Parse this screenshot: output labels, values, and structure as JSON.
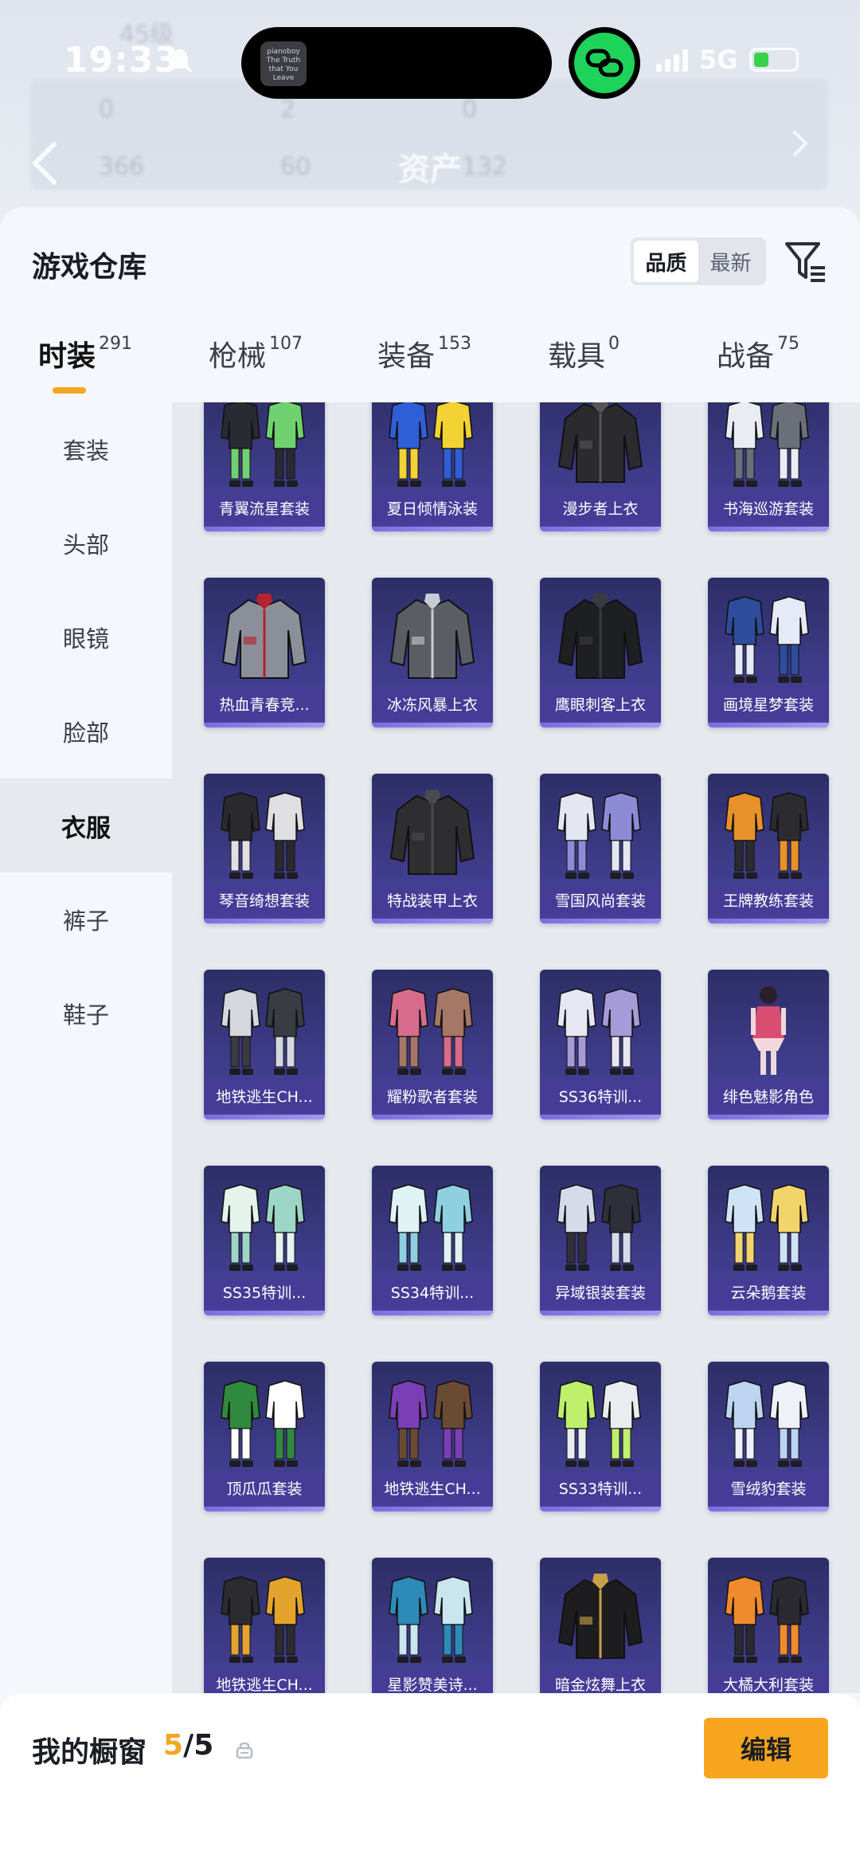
{
  "status_bar": {
    "time": "19:33",
    "network": "5G",
    "island_thumb_text": "pianoboy The Truth that You Leave"
  },
  "backdrop": {
    "title": "资产",
    "ghost_texts": [
      "45级",
      "0",
      "2",
      "0",
      "366",
      "60",
      "132"
    ]
  },
  "header": {
    "title": "游戏仓库",
    "sort_options": [
      "品质",
      "最新"
    ],
    "sort_active": "品质"
  },
  "tabs": [
    {
      "label": "时装",
      "count": "291",
      "active": true
    },
    {
      "label": "枪械",
      "count": "107",
      "active": false
    },
    {
      "label": "装备",
      "count": "153",
      "active": false
    },
    {
      "label": "载具",
      "count": "0",
      "active": false
    },
    {
      "label": "战备",
      "count": "75",
      "active": false
    }
  ],
  "sidebar": {
    "items": [
      "套装",
      "头部",
      "眼镜",
      "脸部",
      "衣服",
      "裤子",
      "鞋子"
    ],
    "active": "衣服"
  },
  "items": [
    {
      "label": "青翼流星套装",
      "type": "set",
      "colors": [
        "#2a2a33",
        "#6fd16f"
      ]
    },
    {
      "label": "夏日倾情泳装",
      "type": "set",
      "colors": [
        "#2f5fd6",
        "#f3d233"
      ]
    },
    {
      "label": "漫步者上衣",
      "type": "jacket",
      "colors": [
        "#2b2b2f",
        "#55565c"
      ]
    },
    {
      "label": "书海巡游套装",
      "type": "set",
      "colors": [
        "#e9ecf3",
        "#6b6f7a"
      ]
    },
    {
      "label": "热血青春竞...",
      "type": "jacket",
      "colors": [
        "#8a8f99",
        "#b8222c"
      ]
    },
    {
      "label": "冰冻风暴上衣",
      "type": "jacket",
      "colors": [
        "#5a5d63",
        "#c9ccd2"
      ]
    },
    {
      "label": "鹰眼刺客上衣",
      "type": "jacket",
      "colors": [
        "#1e1f22",
        "#3a3b40"
      ]
    },
    {
      "label": "画境星梦套装",
      "type": "set",
      "colors": [
        "#2d4d9c",
        "#e6e9f6"
      ]
    },
    {
      "label": "琴音绮想套装",
      "type": "set",
      "colors": [
        "#2a2a2e",
        "#e0e0e4"
      ]
    },
    {
      "label": "特战装甲上衣",
      "type": "jacket",
      "colors": [
        "#2e2e31",
        "#4a4a50"
      ]
    },
    {
      "label": "雪国风尚套装",
      "type": "set",
      "colors": [
        "#e4e7f1",
        "#8e8bd6"
      ]
    },
    {
      "label": "王牌教练套装",
      "type": "set",
      "colors": [
        "#e6912a",
        "#2b2b30"
      ]
    },
    {
      "label": "地铁逃生CH...",
      "type": "set",
      "colors": [
        "#d4d7de",
        "#3a3c44"
      ]
    },
    {
      "label": "耀粉歌者套装",
      "type": "set",
      "colors": [
        "#d76b8b",
        "#a57767"
      ]
    },
    {
      "label": "SS36特训...",
      "type": "set",
      "colors": [
        "#e6e7f2",
        "#a59bd8"
      ]
    },
    {
      "label": "绯色魅影角色",
      "type": "figure",
      "colors": [
        "#d94d73",
        "#f2d7dc"
      ]
    },
    {
      "label": "SS35特训...",
      "type": "set",
      "colors": [
        "#e4f3ec",
        "#9dd6c6"
      ]
    },
    {
      "label": "SS34特训...",
      "type": "set",
      "colors": [
        "#dff2f4",
        "#8fd0e0"
      ]
    },
    {
      "label": "异域银装套装",
      "type": "set",
      "colors": [
        "#d6dbea",
        "#2f2f3a"
      ]
    },
    {
      "label": "云朵鹅套装",
      "type": "set",
      "colors": [
        "#cfe3f7",
        "#f1d56a"
      ]
    },
    {
      "label": "顶瓜瓜套装",
      "type": "set",
      "colors": [
        "#2f8a3d",
        "#ffffff"
      ]
    },
    {
      "label": "地铁逃生CH...",
      "type": "set",
      "colors": [
        "#7a3fb4",
        "#6b4a33"
      ]
    },
    {
      "label": "SS33特训...",
      "type": "set",
      "colors": [
        "#bff06c",
        "#e9edf0"
      ]
    },
    {
      "label": "雪绒豹套装",
      "type": "set",
      "colors": [
        "#bcd4f2",
        "#eef1f8"
      ]
    },
    {
      "label": "地铁逃生CH...",
      "type": "set",
      "colors": [
        "#2b2b30",
        "#e3a42e"
      ]
    },
    {
      "label": "星影赞美诗...",
      "type": "set",
      "colors": [
        "#2e8ab8",
        "#c9e6f0"
      ]
    },
    {
      "label": "暗金炫舞上衣",
      "type": "jacket",
      "colors": [
        "#1d1d20",
        "#c9a04a"
      ]
    },
    {
      "label": "大橘大利套装",
      "type": "set",
      "colors": [
        "#f08a2c",
        "#2a2a30"
      ]
    }
  ],
  "showcase": {
    "title": "我的橱窗",
    "current": "5",
    "separator": "/",
    "total": "5",
    "edit_label": "编辑"
  },
  "colors": {
    "accent": "#f7a51e",
    "card_bg": "#3d3a86"
  }
}
